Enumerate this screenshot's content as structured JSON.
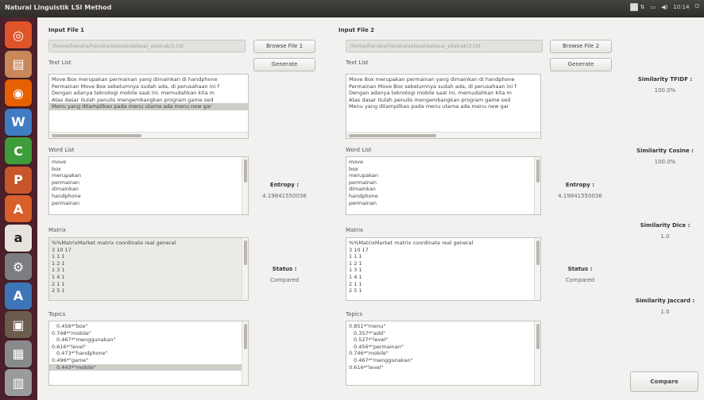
{
  "window_title": "Natural Linguistik LSI Method",
  "tray": {
    "icons": [
      "dropbox-icon",
      "keyboard-icon",
      "network-icon",
      "battery-icon",
      "volume-icon"
    ],
    "time": "10:14"
  },
  "launcher": [
    {
      "name": "ubuntu-home-icon",
      "glyph": "◎",
      "color": "#e0542a"
    },
    {
      "name": "files-icon",
      "glyph": "▤",
      "color": "#c9875a"
    },
    {
      "name": "firefox-icon",
      "glyph": "◉",
      "color": "#e66000"
    },
    {
      "name": "writer-icon",
      "glyph": "W",
      "color": "#3f7cc2"
    },
    {
      "name": "calc-icon",
      "glyph": "C",
      "color": "#3e9c3a"
    },
    {
      "name": "impress-icon",
      "glyph": "P",
      "color": "#c7562a"
    },
    {
      "name": "software-center-icon",
      "glyph": "A",
      "color": "#d9602b"
    },
    {
      "name": "amazon-icon",
      "glyph": "a",
      "color": "#e6e3dc"
    },
    {
      "name": "settings-icon",
      "glyph": "⚙",
      "color": "#7c7d80"
    },
    {
      "name": "update-icon",
      "glyph": "A",
      "color": "#3e74b8"
    },
    {
      "name": "photos-icon",
      "glyph": "▣",
      "color": "#6b5c4e"
    },
    {
      "name": "terminal-icon",
      "glyph": "▦",
      "color": "#888a8c"
    },
    {
      "name": "trash-icon",
      "glyph": "▥",
      "color": "#9a9b9c"
    }
  ],
  "left": {
    "input_label": "Input File 1",
    "input_value": "/home/hendra/hendra/selesai/selesai_ekstrak/1.txt",
    "browse_label": "Browse File 1",
    "text_label": "Text List",
    "generate_label": "Generate",
    "text_lines": [
      "Move Box merupakan permainan yang dimainkan di handphone",
      "Permainan Move Box sebelumnya sudah ada, di perusahaan ini f",
      "Dengan adanya teknologi mobile saat ini, memudahkan kita m",
      "Atas dasar itulah penulis mengembangkan program game sed",
      "Menu yang ditampilkan pada menu utama ada menu new gar"
    ],
    "word_label": "Word List",
    "words": [
      "move",
      "box",
      "merupakan",
      "permainan",
      "dimainkan",
      "handphone",
      "permainan"
    ],
    "matrix_label": "Matrix",
    "matrix": [
      "%%MatrixMarket matrix coordinate real general",
      "3 10 17",
      "1 1 1",
      "1 2 1",
      "1 3 1",
      "1 4 1",
      "2 1 1",
      "2 5 1"
    ],
    "topic_label": "Topics",
    "topics": [
      "0.456*\"box\"",
      "0.748*\"mobile\"",
      "0.467*\"menggunakan\"",
      "0.616*\"level\"",
      "0.473*\"handphone\"",
      "0.496*\"game\"",
      "0.443*\"mobile\""
    ],
    "entropy_label": "Entropy :",
    "entropy_value": "4.19841550036",
    "status_label": "Status :",
    "status_value": "Compared"
  },
  "right": {
    "input_label": "Input File 2",
    "input_value": "/home/hendra/hendra/selesai/selesai_ekstrak/2.txt",
    "browse_label": "Browse File 2",
    "text_label": "Text List",
    "generate_label": "Generate",
    "text_lines": [
      "Move Box merupakan permainan yang dimainkan di handphone",
      "Permainan Move Box sebelumnya sudah ada, di perusahaan ini f",
      "Dengan adanya teknologi mobile saat ini, memudahkan kita m",
      "Atas dasar itulah penulis mengembangkan program game sed",
      "Menu yang ditampilkan pada menu utama ada menu new gar"
    ],
    "word_label": "Word List",
    "words": [
      "move",
      "box",
      "merupakan",
      "permainan",
      "dimainkan",
      "handphone",
      "permainan"
    ],
    "matrix_label": "Matrix",
    "matrix": [
      "%%MatrixMarket matrix coordinate real general",
      "3 10 17",
      "1 1 1",
      "1 2 1",
      "1 3 1",
      "1 4 1",
      "2 1 1",
      "2 5 1"
    ],
    "topic_label": "Topics",
    "topics": [
      "0.851*\"menu\"",
      "0.357*\"add\"",
      "0.527*\"level\"",
      "0.456*\"permainan\"",
      "0.746*\"mobile\"",
      "0.467*\"menggunakan\"",
      "0.616*\"level\""
    ],
    "entropy_label": "Entropy :",
    "entropy_value": "4.19841550036",
    "status_label": "Status :",
    "status_value": "Compared"
  },
  "similarity": {
    "tfidf_label": "Similarity TFIDF :",
    "tfidf_value": "100.0%",
    "cosine_label": "Similarity Cosine :",
    "cosine_value": "100.0%",
    "dice_label": "Similarity Dice :",
    "dice_value": "1.0",
    "jaccard_label": "Similarity Jaccard :",
    "jaccard_value": "1.0",
    "compare_label": "Compare"
  }
}
